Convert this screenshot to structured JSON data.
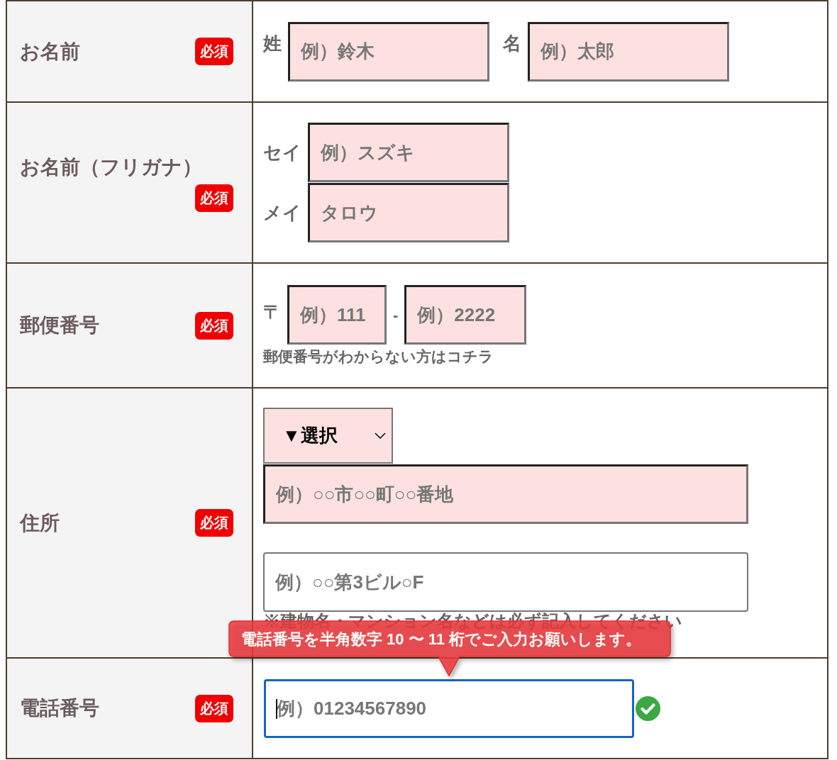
{
  "form": {
    "rows": [
      {
        "kind": "name",
        "label": "お名前",
        "badge": "必須",
        "fields": [
          {
            "prefix": "姓",
            "placeholder": "例）鈴木",
            "highlighted": true,
            "focused": false,
            "valid": false
          },
          {
            "prefix": "名",
            "placeholder": "例）太郎",
            "highlighted": true,
            "focused": false,
            "valid": false
          }
        ]
      },
      {
        "kind": "kana",
        "label": "お名前（フリガナ）",
        "badge": "必須",
        "fields": [
          {
            "prefix": "セイ",
            "placeholder": "例）スズキ",
            "highlighted": true,
            "focused": false,
            "valid": false
          },
          {
            "prefix": "メイ",
            "placeholder": "タロウ",
            "highlighted": true,
            "focused": false,
            "valid": false
          }
        ]
      },
      {
        "kind": "postal",
        "label": "郵便番号",
        "badge": "必須",
        "prefix": "〒",
        "separator": "-",
        "fields": [
          {
            "placeholder": "例）111",
            "highlighted": true,
            "focused": false,
            "valid": false
          },
          {
            "placeholder": "例）2222",
            "highlighted": true,
            "focused": false,
            "valid": false
          }
        ],
        "link": "郵便番号がわからない方はコチラ"
      },
      {
        "kind": "address",
        "label": "住所",
        "badge": "必須",
        "select": {
          "value": "▼選択"
        },
        "fields": [
          {
            "placeholder": "例）○○市○○町○○番地",
            "highlighted": true,
            "focused": false,
            "valid": false
          },
          {
            "placeholder": "例）○○第3ビル○F",
            "highlighted": false,
            "focused": false,
            "valid": false
          }
        ],
        "note": "※建物名・マンション名などは必ず記入してください"
      },
      {
        "kind": "phone",
        "label": "電話番号",
        "badge": "必須",
        "fields": [
          {
            "placeholder": "例）01234567890",
            "highlighted": false,
            "focused": true,
            "valid": true
          }
        ],
        "tooltip": "電話番号を半角数字 10 〜 11 桁でご入力お願いします。"
      }
    ]
  }
}
